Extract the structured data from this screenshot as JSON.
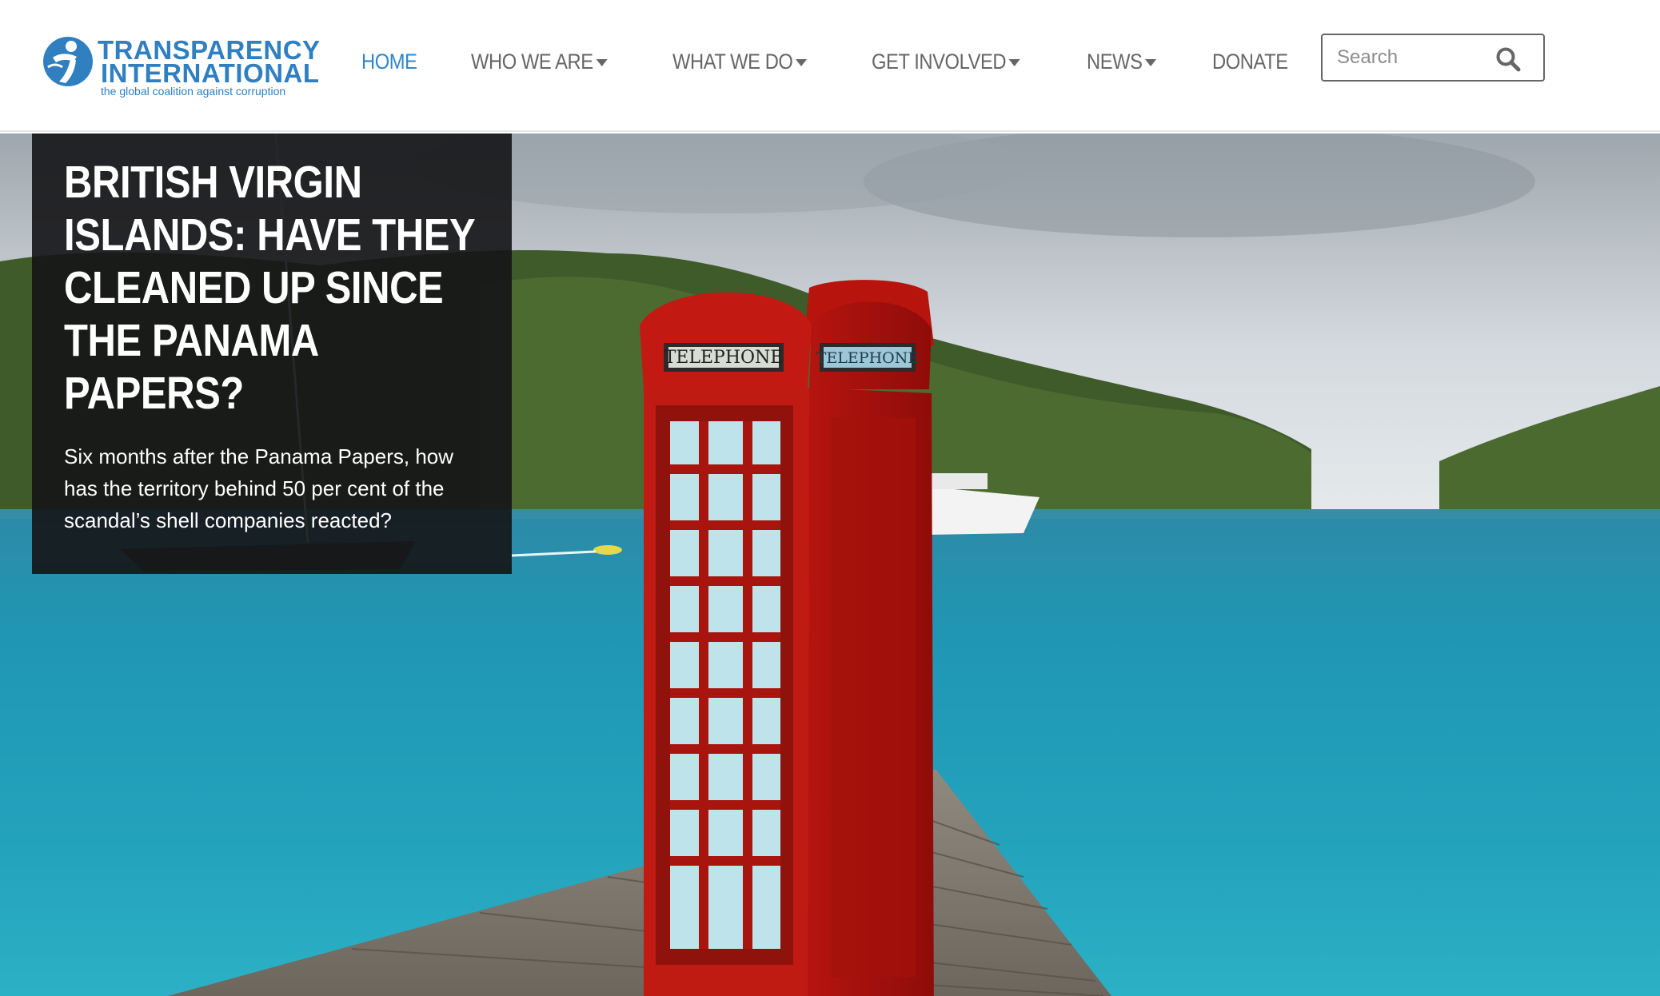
{
  "logo": {
    "line1": "TRANSPARENCY",
    "line2": "INTERNATIONAL",
    "tagline": "the global coalition against corruption"
  },
  "nav": {
    "items": [
      {
        "label": "HOME",
        "active": true,
        "dropdown": false
      },
      {
        "label": "WHO WE ARE",
        "active": false,
        "dropdown": true
      },
      {
        "label": "WHAT WE DO",
        "active": false,
        "dropdown": true
      },
      {
        "label": "GET INVOLVED",
        "active": false,
        "dropdown": true
      },
      {
        "label": "NEWS",
        "active": false,
        "dropdown": true
      },
      {
        "label": "DONATE",
        "active": false,
        "dropdown": false
      }
    ]
  },
  "search": {
    "placeholder": "Search",
    "value": "",
    "icon": "search-icon"
  },
  "hero": {
    "title": "BRITISH VIRGIN ISLANDS: HAVE THEY CLEANED UP SINCE THE PANAMA PAPERS?",
    "summary": "Six months after the Panama Papers, how has the territory behind 50 per cent of the scandal’s shell companies reacted?",
    "booth_sign": "TELEPHONE"
  },
  "colors": {
    "brand_blue": "#2f7fc1",
    "nav_active": "#2f86c8",
    "nav_text": "#666666",
    "overlay_bg": "#141416"
  }
}
